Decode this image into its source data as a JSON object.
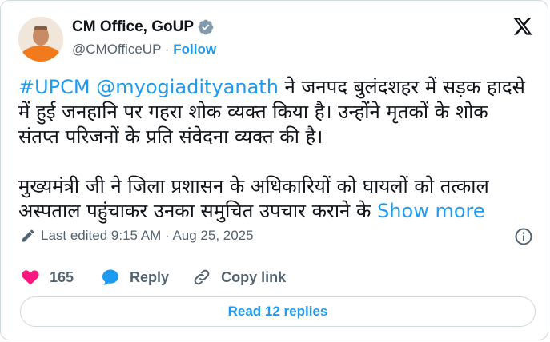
{
  "author": {
    "name": "CM Office, GoUP",
    "handle": "@CMOfficeUP",
    "separator": "·",
    "follow_label": "Follow",
    "verified_color": "#829aab"
  },
  "tweet": {
    "hashtag": "#UPCM",
    "mention": "@myogiadityanath",
    "paragraph1_rest": " ने जनपद बुलंदशहर में सड़क हादसे में हुई जनहानि पर गहरा शोक व्यक्त किया है। उन्होंने मृतकों के शोक संतप्त परिजनों के प्रति संवेदना व्यक्त की है।",
    "paragraph2": "मुख्यमंत्री जी ने जिला प्रशासन के अधिकारियों को घायलों को तत्काल अस्पताल पहुंचाकर उनका समुचित उपचार कराने के ",
    "show_more": "Show more"
  },
  "meta": {
    "edited": "Last edited 9:15 AM · Aug 25, 2025"
  },
  "actions": {
    "like_count": "165",
    "reply_label": "Reply",
    "copy_label": "Copy link"
  },
  "read_replies": "Read 12 replies",
  "colors": {
    "accent": "#1d9bf0",
    "like": "#f91880",
    "muted": "#536471"
  }
}
